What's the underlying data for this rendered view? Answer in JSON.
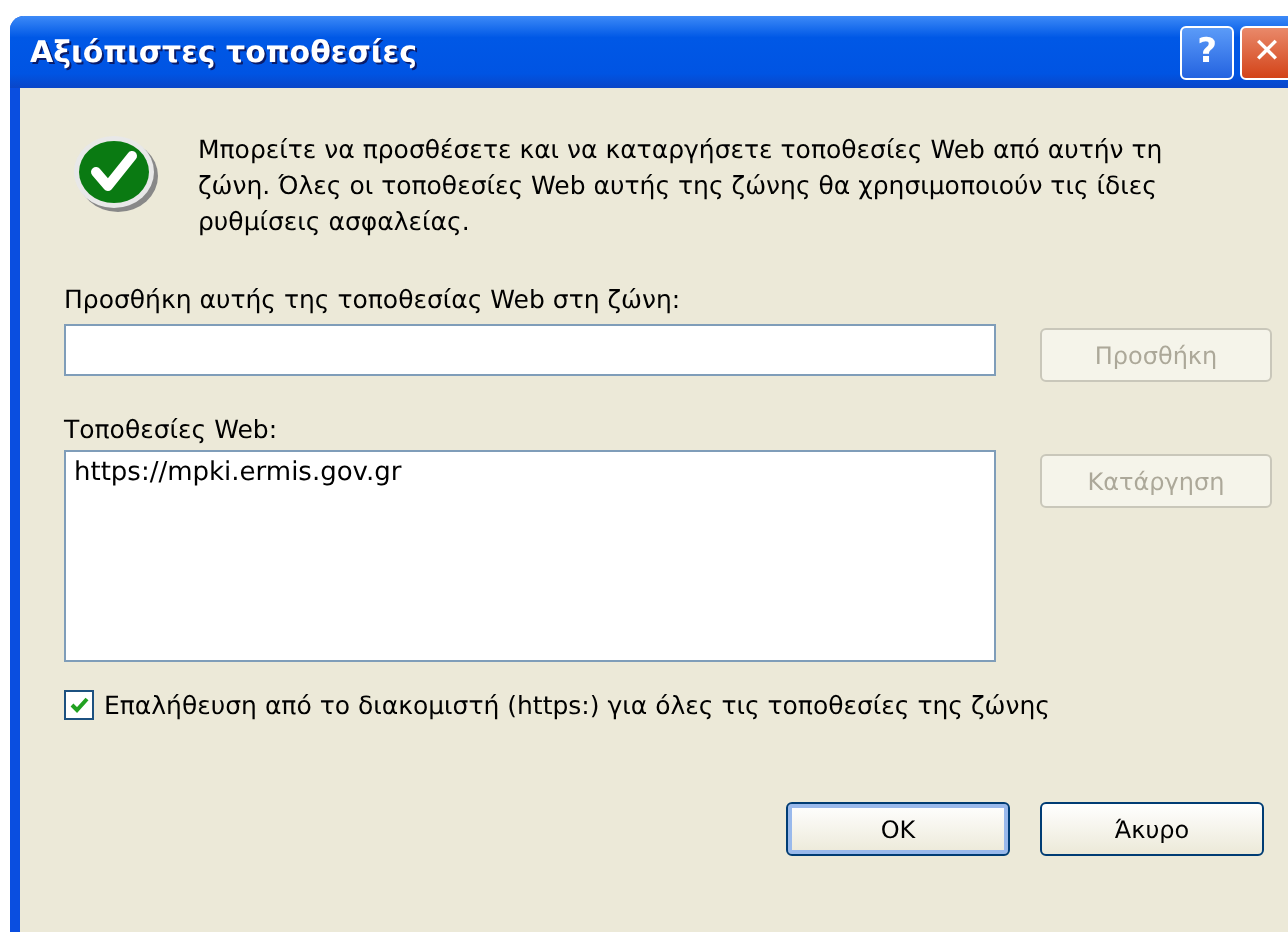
{
  "window": {
    "title": "Αξιόπιστες τοποθεσίες",
    "buttons": [
      {
        "kind": "help",
        "label": "?"
      },
      {
        "kind": "close",
        "label": "✕"
      }
    ]
  },
  "message": "Μπορείτε να προσθέσετε και να καταργήσετε τοποθεσίες Web από αυτήν τη ζώνη. Όλες οι τοποθεσίες Web αυτής της ζώνης θα χρησιμοποιούν τις ίδιες ρυθμίσεις ασφαλείας.",
  "add_label": "Προσθήκη αυτής της τοποθεσίας Web στη ζώνη:",
  "add_button": {
    "label": "Προσθήκη",
    "disabled": true
  },
  "sites_label": "Τοποθεσίες Web:",
  "sites": [
    {
      "text": "https://mpki.ermis.gov.gr",
      "selected": false
    }
  ],
  "remove_button": {
    "label": "Κατάργηση",
    "disabled": true
  },
  "https_check": {
    "label": "Επαλήθευση από το διακομιστή (https:) για όλες τις τοποθεσίες της ζώνης",
    "checked": true
  },
  "buttons": [
    {
      "label": "OK",
      "default": true
    },
    {
      "label": "Άκυρο",
      "default": false
    }
  ]
}
